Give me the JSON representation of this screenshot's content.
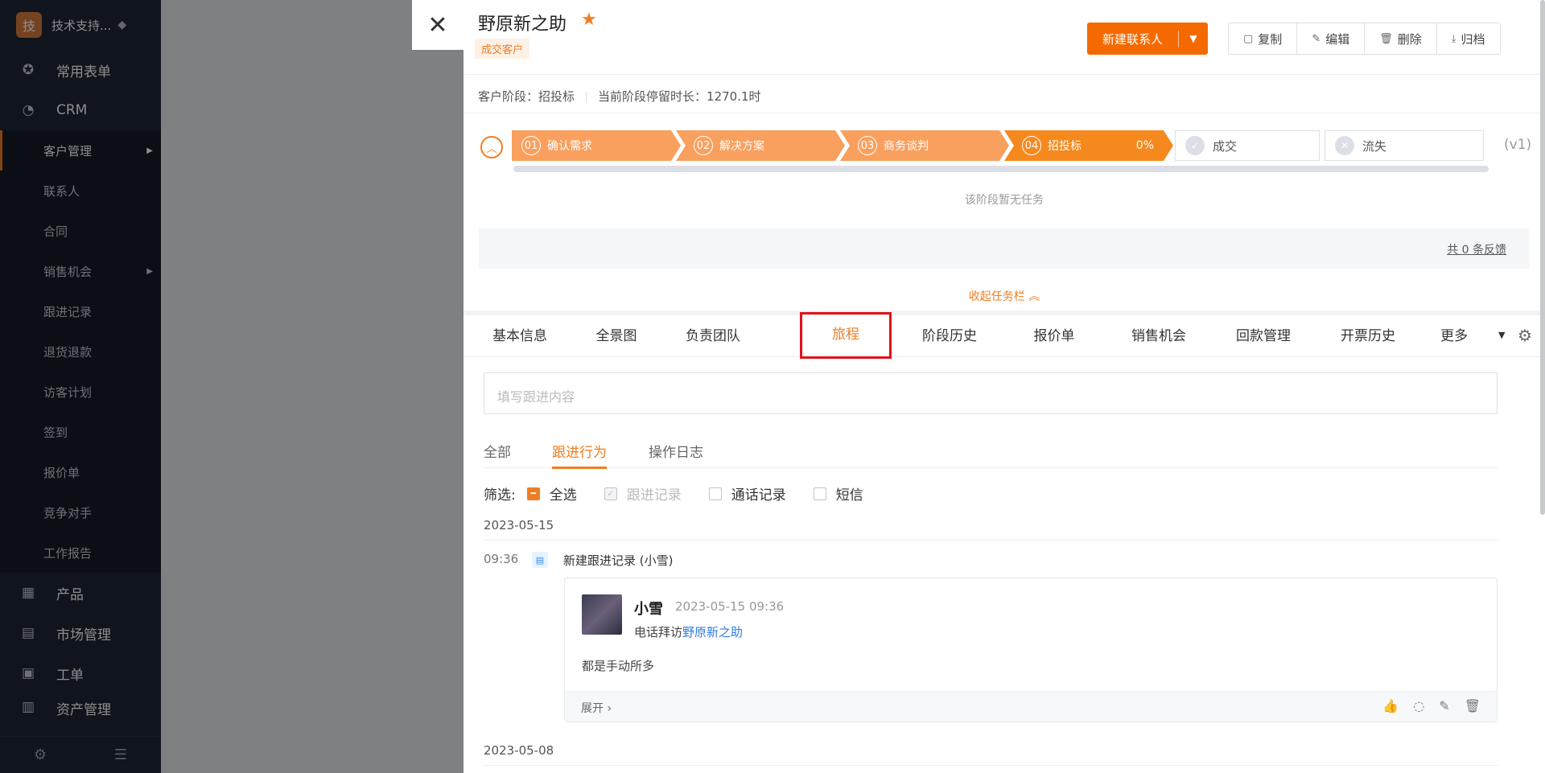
{
  "sidebar": {
    "avatar_char": "技",
    "user": "技术支持...",
    "groups": {
      "forms": "常用表单",
      "crm": "CRM",
      "product": "产品",
      "market": "市场管理",
      "ticket": "工单",
      "assets": "资产管理"
    },
    "items": [
      "客户管理",
      "联系人",
      "合同",
      "销售机会",
      "跟进记录",
      "退货退款",
      "访客计划",
      "签到",
      "报价单",
      "竞争对手",
      "工作报告"
    ]
  },
  "drawer": {
    "title": "野原新之助",
    "badge": "成交客户",
    "actions": {
      "new_contact": "新建联系人",
      "copy": "复制",
      "edit": "编辑",
      "delete": "删除",
      "archive": "归档"
    },
    "stage_label": "客户阶段：",
    "stage_value": "招投标",
    "duration_label": "当前阶段停留时长：",
    "duration_value": "1270.1时",
    "steps": [
      {
        "num": "01",
        "label": "确认需求"
      },
      {
        "num": "02",
        "label": "解决方案"
      },
      {
        "num": "03",
        "label": "商务谈判"
      },
      {
        "num": "04",
        "label": "招投标",
        "percent": "0%"
      }
    ],
    "won_label": "成交",
    "lost_label": "流失",
    "version": "(v1)",
    "no_task": "该阶段暂无任务",
    "feedback": "共 0 条反馈",
    "collapse": "收起任务栏",
    "tabs": [
      "基本信息",
      "全景图",
      "负责团队",
      "旅程",
      "阶段历史",
      "报价单",
      "销售机会",
      "回款管理",
      "开票历史",
      "更多"
    ],
    "followup_placeholder": "填写跟进内容",
    "subtabs": [
      "全部",
      "跟进行为",
      "操作日志"
    ],
    "filter": {
      "label": "筛选:",
      "all": "全选",
      "record": "跟进记录",
      "call": "通话记录",
      "sms": "短信"
    },
    "timeline": {
      "date1": "2023-05-15",
      "event_time": "09:36",
      "event_title": "新建跟进记录 (小雪)",
      "card_name": "小雪",
      "card_time": "2023-05-15 09:36",
      "card_action": "电话拜访",
      "card_link": "野原新之助",
      "card_body": "都是手动所多",
      "expand": "展开",
      "date2": "2023-05-08"
    }
  },
  "colors": {
    "accent": "#f07d22",
    "primary_button": "#f56a00",
    "sidebar_bg": "#1e2534",
    "highlight_box": "#e0121b",
    "link": "#2e7de0"
  }
}
